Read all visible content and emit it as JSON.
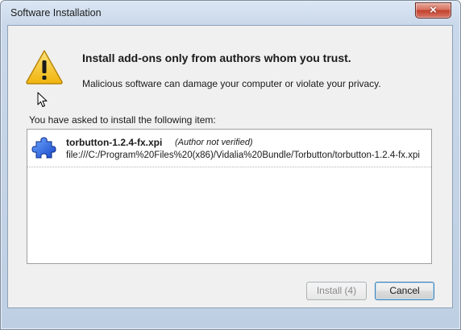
{
  "window": {
    "title": "Software Installation",
    "close_label": "×"
  },
  "message": {
    "heading": "Install add-ons only from authors whom you trust.",
    "subtext": "Malicious software can damage your computer or violate your privacy.",
    "icon": "warning-icon"
  },
  "list": {
    "label": "You have asked to install the following item:",
    "items": [
      {
        "name": "torbutton-1.2.4-fx.xpi",
        "verification": "(Author not verified)",
        "url": "file:///C:/Program%20Files%20(x86)/Vidalia%20Bundle/Torbutton/torbutton-1.2.4-fx.xpi",
        "icon": "puzzle-piece-icon"
      }
    ]
  },
  "buttons": {
    "install_label": "Install (4)",
    "cancel_label": "Cancel"
  },
  "colors": {
    "accent": "#3c7fb1",
    "warning": "#f5c518",
    "close": "#c2402a"
  }
}
